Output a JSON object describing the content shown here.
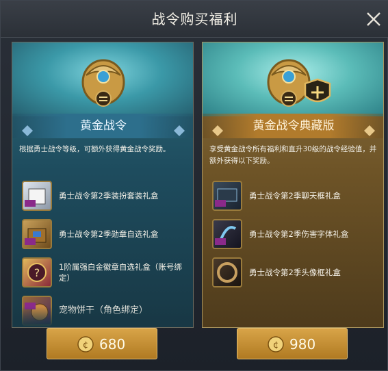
{
  "dialog": {
    "title": "战令购买福利"
  },
  "panels": [
    {
      "banner": "黄金战令",
      "description": "根据勇士战令等级，可额外获得黄金战令奖励。",
      "items": [
        {
          "label": "勇士战令第2季装扮套装礼盒",
          "icon": "gift-box-icon"
        },
        {
          "label": "勇士战令第2季勋章自选礼盒",
          "icon": "treasure-chest-icon"
        },
        {
          "label": "1阶属强白金徽章自选礼盒（账号绑定）",
          "icon": "mystery-box-icon"
        },
        {
          "label": "宠物饼干（角色绑定）",
          "icon": "pet-cookie-icon"
        }
      ],
      "price": "680"
    },
    {
      "banner": "黄金战令典藏版",
      "description": "享受黄金战令所有福利和直升30级的战令经验值，并额外获得以下奖励。",
      "items": [
        {
          "label": "勇士战令第2季聊天框礼盒",
          "icon": "chat-frame-icon"
        },
        {
          "label": "勇士战令第2季伤害字体礼盒",
          "icon": "damage-font-icon"
        },
        {
          "label": "勇士战令第2季头像框礼盒",
          "icon": "avatar-frame-icon"
        }
      ],
      "price": "980"
    }
  ],
  "colors": {
    "gold": "#c89436",
    "teal": "#2c6a7a",
    "brown": "#6e5427"
  }
}
